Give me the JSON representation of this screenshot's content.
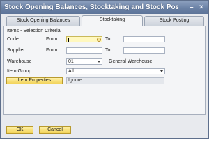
{
  "window": {
    "title": "Stock Opening Balances, Stocktaking and Stock Posting - S",
    "minimize_glyph": "–",
    "close_glyph": "✕"
  },
  "tabs": [
    {
      "label": "Stock Opening Balances",
      "active": false
    },
    {
      "label": "Stocktaking",
      "active": true
    },
    {
      "label": "Stock Posting",
      "active": false
    }
  ],
  "section": {
    "title": "Items - Selection Criteria"
  },
  "code": {
    "label": "Code",
    "from_label": "From",
    "from_value": "",
    "to_label": "To",
    "to_value": ""
  },
  "supplier": {
    "label": "Supplier",
    "from_label": "From",
    "from_value": "",
    "to_label": "To",
    "to_value": ""
  },
  "warehouse": {
    "label": "Warehouse",
    "value": "01",
    "name": "General Warehouse"
  },
  "item_group": {
    "label": "Item Group",
    "value": "All"
  },
  "item_properties": {
    "button_label": "Item Properties",
    "value": "Ignore"
  },
  "footer": {
    "ok_label": "OK",
    "cancel_label": "Cancel"
  }
}
